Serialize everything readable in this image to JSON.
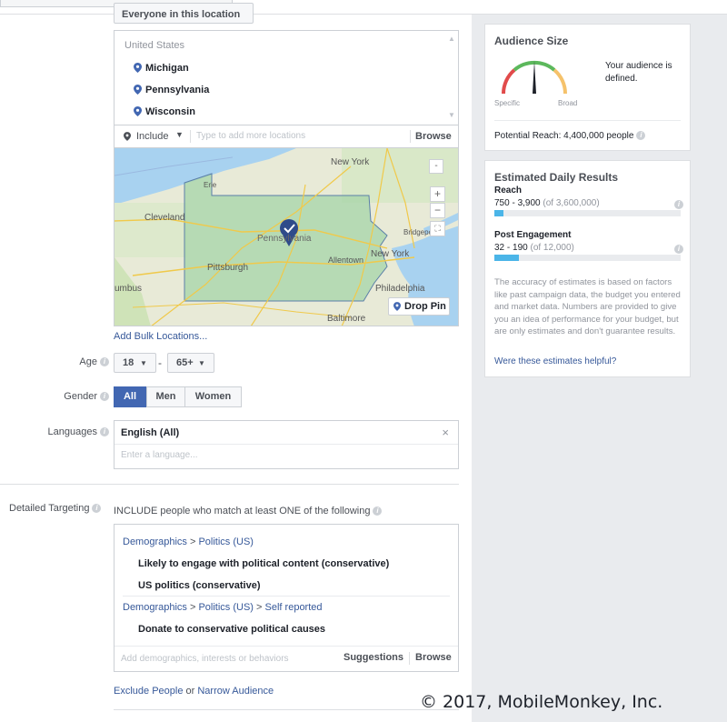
{
  "location": {
    "audience_button": "Everyone in this location",
    "country": "United States",
    "items": [
      "Michigan",
      "Pennsylvania",
      "Wisconsin"
    ],
    "include_label": "Include",
    "input_placeholder": "Type to add more locations",
    "browse_label": "Browse",
    "add_bulk": "Add Bulk Locations..."
  },
  "map": {
    "labels": [
      "Erie",
      "New York",
      "Cleveland",
      "Pennsylvania",
      "Bridgeport",
      "New York",
      "Pittsburgh",
      "Allentown",
      "umbus",
      "Philadelphia",
      "Baltimore"
    ],
    "zoom_in": "+",
    "zoom_out": "−",
    "drop_pin": "Drop Pin"
  },
  "age": {
    "label": "Age",
    "min": "18",
    "max": "65+"
  },
  "gender": {
    "label": "Gender",
    "options": [
      "All",
      "Men",
      "Women"
    ],
    "selected": "All"
  },
  "languages": {
    "label": "Languages",
    "selected": "English (All)",
    "placeholder": "Enter a language..."
  },
  "detailed_targeting": {
    "label": "Detailed Targeting",
    "include_text": "INCLUDE people who match at least ONE of the following",
    "groups": [
      {
        "crumb": [
          "Demographics",
          "Politics (US)"
        ],
        "items": [
          "Likely to engage with political content (conservative)",
          "US politics (conservative)"
        ]
      },
      {
        "crumb": [
          "Demographics",
          "Politics (US)",
          "Self reported"
        ],
        "items": [
          "Donate to conservative political causes"
        ]
      }
    ],
    "input_placeholder": "Add demographics, interests or behaviors",
    "suggestions": "Suggestions",
    "browse": "Browse",
    "exclude_link": "Exclude People",
    "or_text": "or",
    "narrow_link": "Narrow Audience"
  },
  "audience_size": {
    "title": "Audience Size",
    "specific": "Specific",
    "broad": "Broad",
    "status": "Your audience is defined.",
    "potential_reach": "Potential Reach: 4,400,000 people"
  },
  "daily_results": {
    "title": "Estimated Daily Results",
    "reach_label": "Reach",
    "reach_range": "750 - 3,900",
    "reach_of": "(of 3,600,000)",
    "reach_fraction": 0.05,
    "engagement_label": "Post Engagement",
    "engagement_range": "32 - 190",
    "engagement_of": "(of 12,000)",
    "engagement_fraction": 0.13,
    "note": "The accuracy of estimates is based on factors like past campaign data, the budget you entered and market data. Numbers are provided to give you an idea of performance for your budget, but are only estimates and don't guarantee results.",
    "helpful_link": "Were these estimates helpful?"
  },
  "watermark": "© 2017, MobileMonkey, Inc.",
  "colors": {
    "accent": "#4267b2",
    "link": "#365899",
    "bar_fill": "#4bb5e8",
    "right_bg": "#e9ebee"
  }
}
